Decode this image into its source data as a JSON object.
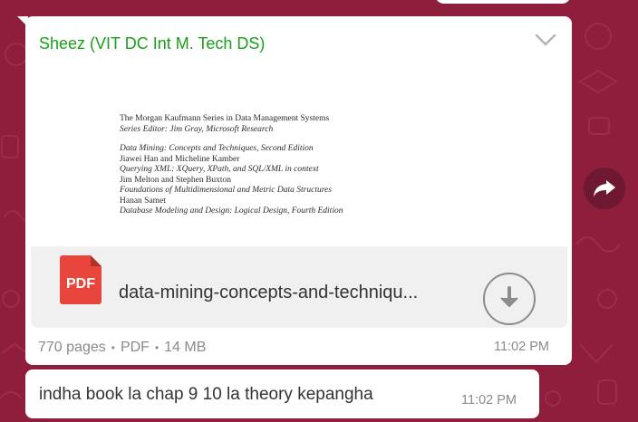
{
  "message": {
    "sender": "Sheez (VIT DC Int M. Tech DS)",
    "pdf_preview_lines": [
      "The Morgan Kaufmann Series in Data Management Systems",
      "Series Editor: Jim Gray, Microsoft Research",
      "Data Mining: Concepts and Techniques, Second Edition",
      "Jiawei Han and Micheline Kamber",
      "Querying XML: XQuery, XPath, and SQL/XML in context",
      "Jim Melton and Stephen Buxton",
      "Foundations of Multidimensional and Metric Data Structures",
      "Hanan Samet",
      "Database Modeling and Design: Logical Design, Fourth Edition"
    ],
    "file": {
      "type_label": "PDF",
      "name": "data-mining-concepts-and-techniqu...",
      "pages": "770 pages",
      "format": "PDF",
      "size": "14 MB",
      "separator": "•"
    },
    "time": "11:02 PM"
  },
  "reply": {
    "text": "indha book la chap 9 10 la theory kepangha",
    "time": "11:02 PM"
  },
  "colors": {
    "wallpaper": "#8f1e3c",
    "sender": "#1aa01a",
    "pdf_badge": "#e8453c",
    "bubble": "#ffffff"
  },
  "icons": {
    "menu": "chevron-down-icon",
    "download": "download-icon",
    "forward": "forward-icon",
    "file": "pdf-icon"
  }
}
